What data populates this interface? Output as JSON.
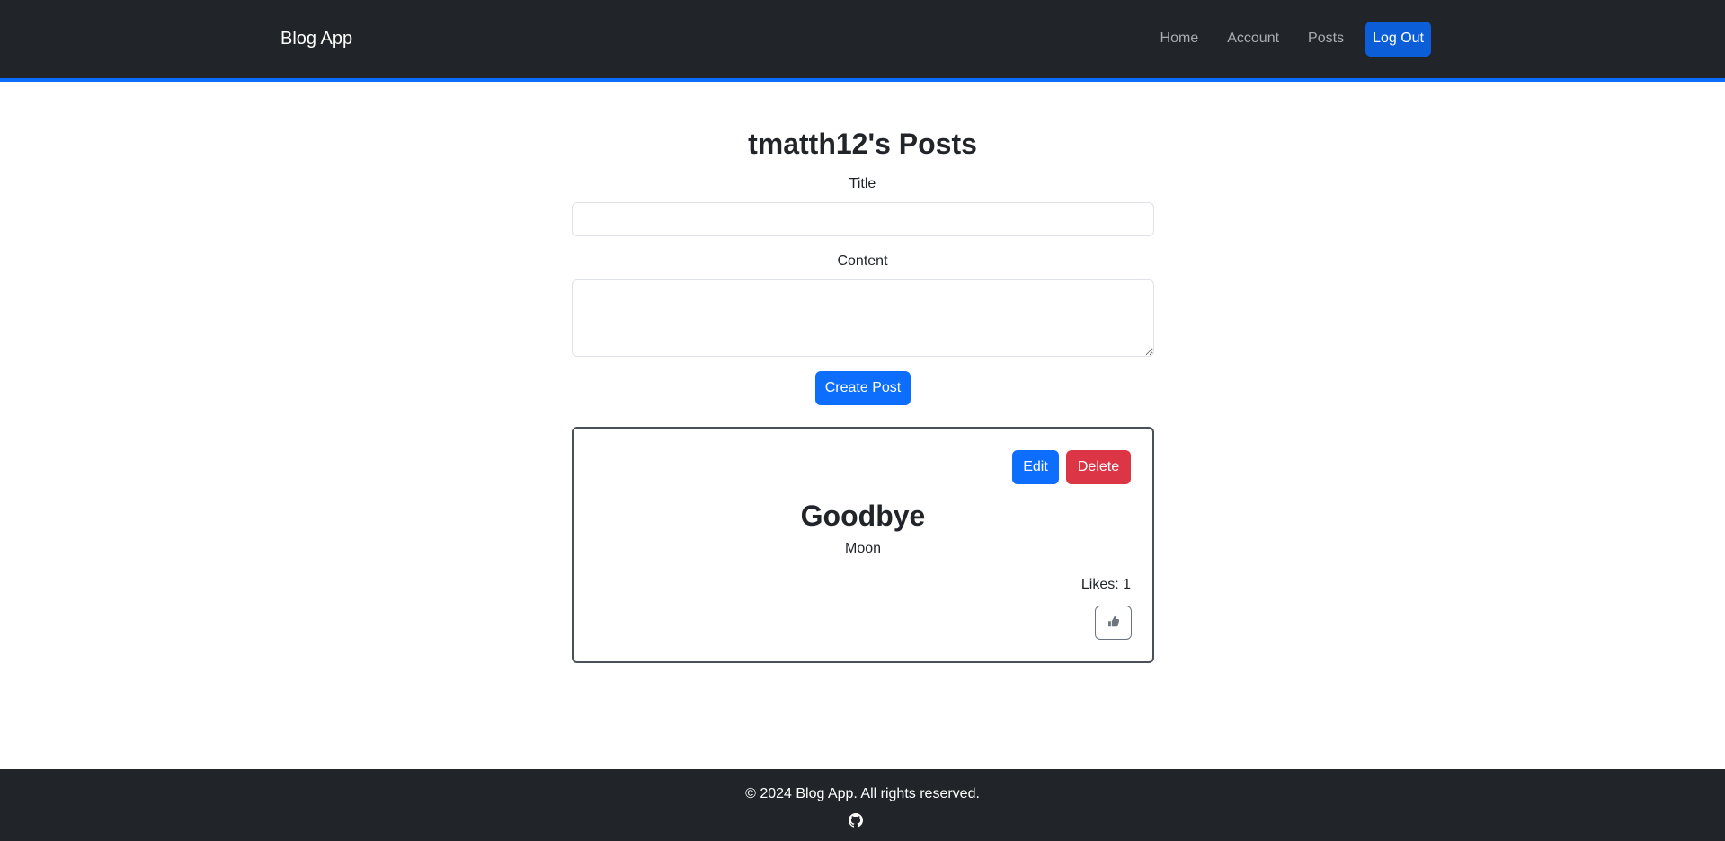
{
  "navbar": {
    "brand": "Blog App",
    "links": [
      {
        "label": "Home"
      },
      {
        "label": "Account"
      },
      {
        "label": "Posts"
      }
    ],
    "logout_label": "Log Out",
    "accent_color": "#0d6efd"
  },
  "main": {
    "title": "tmatth12's Posts",
    "form": {
      "title_label": "Title",
      "title_value": "",
      "content_label": "Content",
      "content_value": "",
      "submit_label": "Create Post"
    },
    "posts": [
      {
        "title": "Goodbye",
        "content": "Moon",
        "likes_text": "Likes: 1",
        "edit_label": "Edit",
        "delete_label": "Delete",
        "like_icon": "thumbs-up-icon"
      }
    ]
  },
  "footer": {
    "text": "© 2024 Blog App. All rights reserved.",
    "icon": "github-icon"
  },
  "colors": {
    "primary": "#0d6efd",
    "danger": "#dc3545",
    "dark": "#212529"
  }
}
